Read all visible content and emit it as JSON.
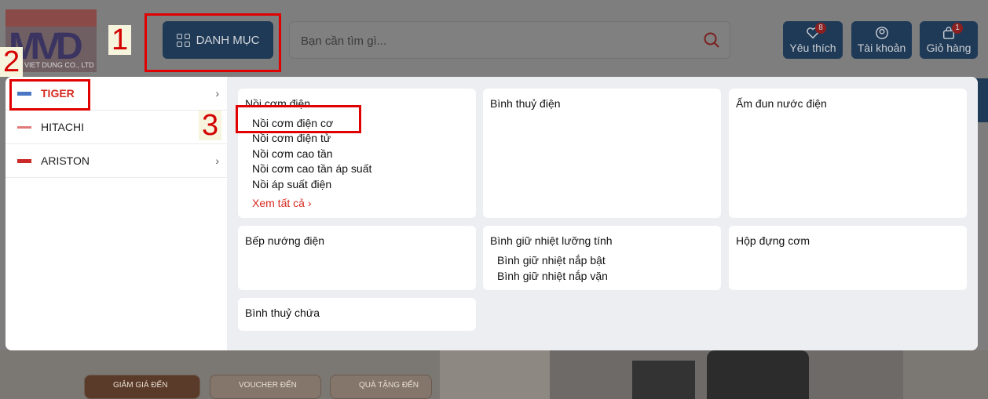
{
  "header": {
    "logo_text": "VIET DUNG CO., LTD",
    "logo_mark": "MVD",
    "category_button": "DANH MỤC",
    "search_placeholder": "Bạn cần tìm gì...",
    "favorites": {
      "label": "Yêu thích",
      "count": "8"
    },
    "account": {
      "label": "Tài khoản"
    },
    "cart": {
      "label": "Giỏ hàng",
      "count": "1"
    }
  },
  "brands": [
    {
      "name": "TIGER",
      "active": true,
      "has_submenu": true
    },
    {
      "name": "HITACHI",
      "active": false,
      "has_submenu": false
    },
    {
      "name": "ARISTON",
      "active": false,
      "has_submenu": true
    }
  ],
  "categories": [
    {
      "title": "Nồi cơm điện",
      "items": [
        "Nồi cơm điện cơ",
        "Nồi cơm điện tử",
        "Nồi cơm cao tần",
        "Nồi cơm cao tần áp suất",
        "Nồi áp suất điện"
      ],
      "see_all": "Xem tất cả"
    },
    {
      "title": "Bình thuỷ điện",
      "items": []
    },
    {
      "title": "Ấm đun nước điện",
      "items": []
    },
    {
      "title": "Bếp nướng điện",
      "items": []
    },
    {
      "title": "Bình giữ nhiệt lưỡng tính",
      "items": [
        "Bình giữ nhiệt nắp bật",
        "Bình giữ nhiệt nắp vặn"
      ]
    },
    {
      "title": "Hộp đựng cơm",
      "items": []
    },
    {
      "title": "Bình thuỷ chứa",
      "items": []
    }
  ],
  "banner": {
    "promo_1": "GIẢM GIÁ ĐẾN",
    "promo_2": "VOUCHER ĐẾN",
    "promo_3": "QUÀ TẶNG ĐẾN"
  },
  "annotations": [
    "1",
    "2",
    "3"
  ],
  "colors": {
    "accent_red": "#d62a20",
    "brand_navy": "#1f3a57",
    "annotation_red": "#e00000"
  }
}
